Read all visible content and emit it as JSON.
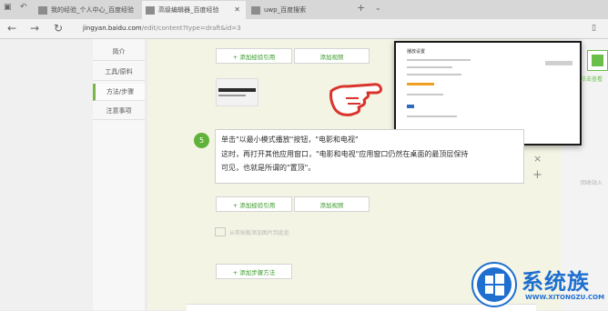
{
  "browser": {
    "tabs": [
      {
        "label": "我的经验_个人中心_百度经验",
        "active": false
      },
      {
        "label": "高级编辑器_百度经验",
        "active": true
      },
      {
        "label": "uwp_百度搜索",
        "active": false
      }
    ],
    "url_domain": "jingyan.baidu.com",
    "url_path": "/edit/content?type=draft&id=3"
  },
  "sidenav": {
    "items": [
      {
        "label": "简介",
        "active": false
      },
      {
        "label": "工具/原料",
        "active": false
      },
      {
        "label": "方法/步骤",
        "active": true
      },
      {
        "label": "注意事项",
        "active": false
      }
    ]
  },
  "editor": {
    "add_reference_label": "+ 添加经验引用",
    "add_video_label": "添加视频",
    "step_number": "5",
    "step_lines": [
      "单击\"以最小模式播放\"按钮，\"电影和电视\"",
      "这时，再打开其他应用窗口，\"电影和电视\"应用窗口仍然在桌面的最顶层保持",
      "可见，也就是所谓的\"置顶\"。"
    ],
    "image_hint": "从剪贴板添加图片到此处",
    "add_step_label": "+ 添加步骤方法",
    "remove_symbol": "×",
    "add_symbol": "+"
  },
  "popup": {
    "title": "播放设置"
  },
  "right": {
    "card_label": "点击查看",
    "note": "回收站入"
  },
  "watermark": {
    "brand": "系统族",
    "url": "WWW.XITONGZU.COM"
  },
  "colors": {
    "accent_green": "#5fb23a",
    "watermark_blue": "#1e6fcf",
    "hand_red": "#d9342b"
  }
}
